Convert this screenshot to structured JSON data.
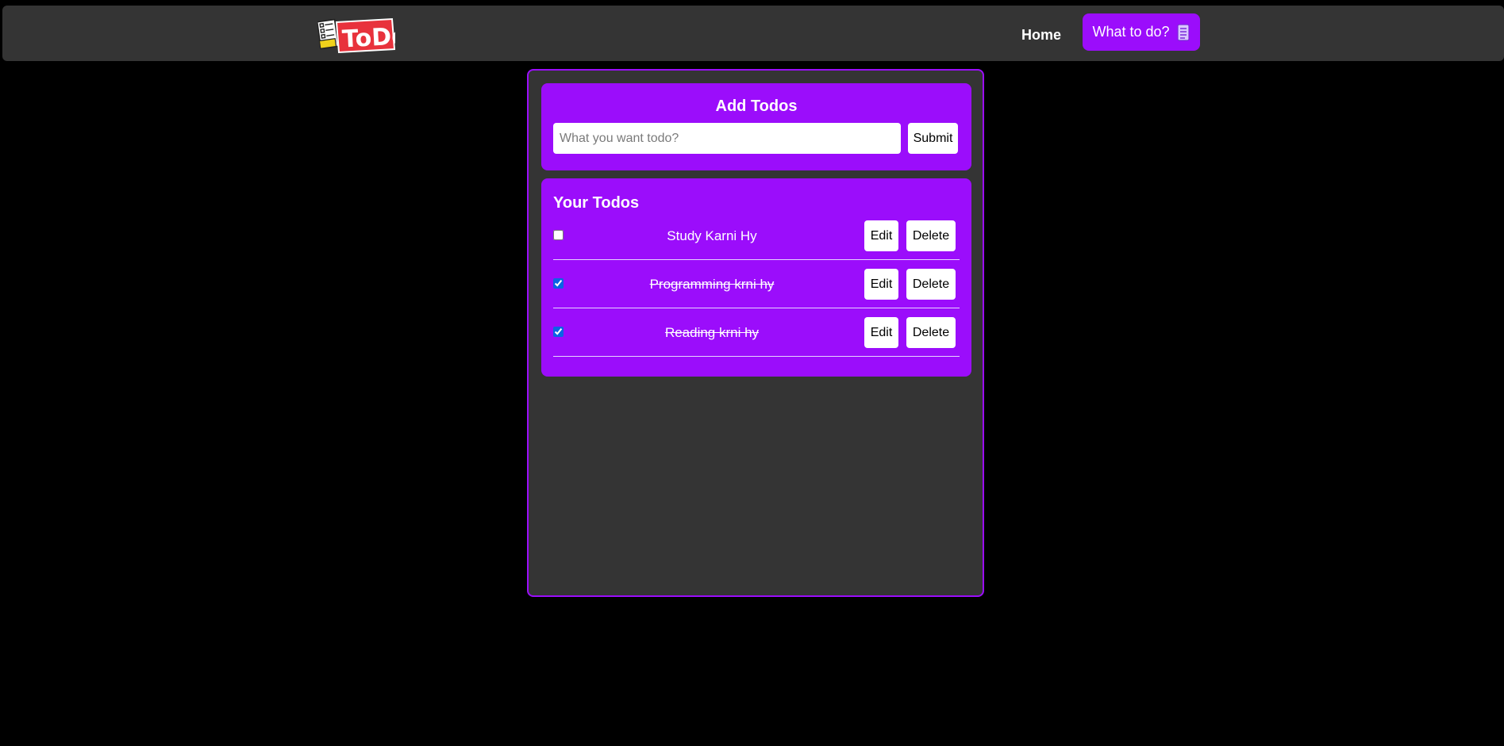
{
  "navbar": {
    "logo_text": "ToDo",
    "home_label": "Home",
    "what_label": "What to do?",
    "what_icon": "memo-icon"
  },
  "add": {
    "title": "Add Todos",
    "placeholder": "What you want todo?",
    "value": "",
    "submit_label": "Submit"
  },
  "list": {
    "title": "Your Todos",
    "edit_label": "Edit",
    "delete_label": "Delete",
    "items": [
      {
        "text": "Study Karni Hy",
        "completed": false
      },
      {
        "text": "Programming krni hy",
        "completed": true
      },
      {
        "text": "Reading krni hy",
        "completed": true
      }
    ]
  },
  "colors": {
    "accent": "#9b0dfb",
    "navbar": "#343434",
    "background": "#000000",
    "logo_red": "#e8323c"
  }
}
